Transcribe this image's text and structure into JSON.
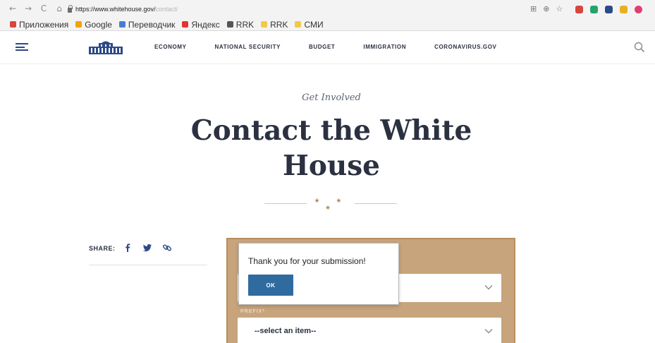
{
  "browser": {
    "nav": {
      "back": "←",
      "forward": "→",
      "reload": "C",
      "home": "⌂"
    },
    "url_host": "https://www.whitehouse.gov/",
    "url_path": "contact/",
    "addr_icons": [
      "translate-icon",
      "zoom-icon",
      "star-icon"
    ],
    "extension_colors": [
      "#d9453a",
      "#25a36b",
      "#2b4a8a",
      "#e8b020",
      "#e23c73"
    ],
    "bookmarks": [
      {
        "label": "Приложения",
        "icon": "apps-grid-icon",
        "color": "#d9453a"
      },
      {
        "label": "Google",
        "icon": "google-icon",
        "color": "#f2a300"
      },
      {
        "label": "Переводчик",
        "icon": "translate-icon",
        "color": "#4a7bd0"
      },
      {
        "label": "Яндекс",
        "icon": "yandex-icon",
        "color": "#e3342f"
      },
      {
        "label": "RRK",
        "icon": "rrk-icon",
        "color": "#555555"
      },
      {
        "label": "RRK",
        "icon": "folder-icon",
        "color": "#f1c94a"
      },
      {
        "label": "СМИ",
        "icon": "folder-icon",
        "color": "#f1c94a"
      }
    ]
  },
  "site_header": {
    "nav": [
      "ECONOMY",
      "NATIONAL SECURITY",
      "BUDGET",
      "IMMIGRATION",
      "CORONAVIRUS.GOV"
    ]
  },
  "hero": {
    "eyebrow": "Get Involved",
    "title_line1": "Contact the White",
    "title_line2": "House",
    "divider_stars": "★ ★ ★"
  },
  "share": {
    "label": "SHARE:"
  },
  "form": {
    "prefix_label": "PREFIX*",
    "prefix_value": "--select an item--",
    "first_select_value": ""
  },
  "modal": {
    "message": "Thank you for your submission!",
    "ok_label": "OK"
  },
  "colors": {
    "brand_navy": "#2c4a87",
    "form_tan": "#c7a47c",
    "button_blue": "#2f6b9e",
    "accent_gold": "#b08a57"
  }
}
